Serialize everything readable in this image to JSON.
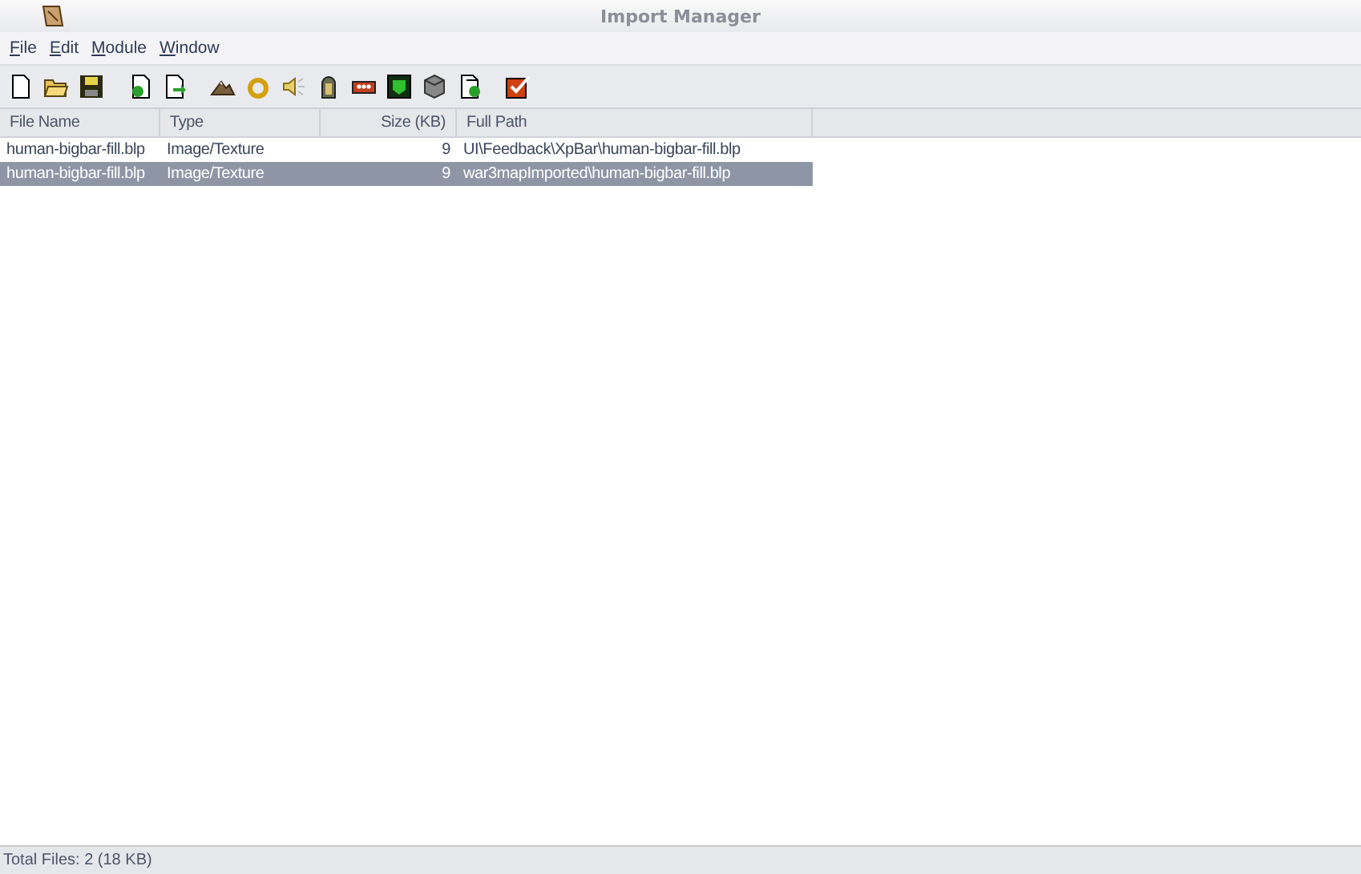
{
  "window": {
    "title": "Import Manager"
  },
  "menu": [
    "File",
    "Edit",
    "Module",
    "Window"
  ],
  "table": {
    "columns": [
      {
        "label": "File Name",
        "kind": "text"
      },
      {
        "label": "Type",
        "kind": "text"
      },
      {
        "label": "Size (KB)",
        "kind": "number"
      },
      {
        "label": "Full Path",
        "kind": "text"
      }
    ],
    "rows": [
      {
        "cells": [
          "human-bigbar-fill.blp",
          "Image/Texture",
          "9",
          "UI\\Feedback\\XpBar\\human-bigbar-fill.blp"
        ],
        "selected": false
      },
      {
        "cells": [
          "human-bigbar-fill.blp",
          "Image/Texture",
          "9",
          "war3mapImported\\human-bigbar-fill.blp"
        ],
        "selected": true
      }
    ]
  },
  "status_bar": "Total Files: 2 (18 KB)"
}
